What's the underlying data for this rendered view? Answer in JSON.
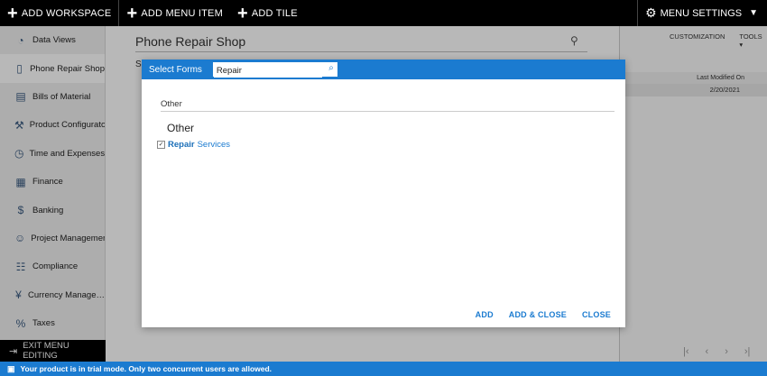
{
  "topbar": {
    "add_workspace": "ADD WORKSPACE",
    "add_menu_item": "ADD MENU ITEM",
    "add_tile": "ADD TILE",
    "menu_settings": "MENU SETTINGS"
  },
  "sidebar": {
    "items": [
      {
        "label": "Data Views",
        "icon": "chart-icon"
      },
      {
        "label": "Phone Repair Shop",
        "icon": "phone-icon"
      },
      {
        "label": "Bills of Material",
        "icon": "document-icon"
      },
      {
        "label": "Product Configurator",
        "icon": "wrench-icon"
      },
      {
        "label": "Time and Expenses",
        "icon": "stopwatch-icon"
      },
      {
        "label": "Finance",
        "icon": "calculator-icon"
      },
      {
        "label": "Banking",
        "icon": "dollar-icon"
      },
      {
        "label": "Project Management",
        "icon": "person-icon"
      },
      {
        "label": "Compliance",
        "icon": "checklist-icon"
      },
      {
        "label": "Currency Manage…",
        "icon": "currency-icon"
      },
      {
        "label": "Taxes",
        "icon": "percent-icon"
      }
    ],
    "exit": "EXIT MENU EDITING"
  },
  "panel": {
    "title": "Phone Repair Shop",
    "subtitle_letter": "S"
  },
  "background": {
    "customization": "CUSTOMIZATION",
    "tools": "TOOLS",
    "column_header": "Last Modified On",
    "row_value": "2/20/2021"
  },
  "dialog": {
    "title": "Select Forms",
    "search_value": "Repair",
    "section": "Other",
    "group": "Other",
    "item_bold": "Repair",
    "item_rest": "Services",
    "add": "ADD",
    "add_close": "ADD & CLOSE",
    "close": "CLOSE"
  },
  "status": {
    "message": "Your product is in trial mode. Only two concurrent users are allowed."
  },
  "colors": {
    "accent": "#1b7bd0",
    "topbar": "#000000"
  }
}
